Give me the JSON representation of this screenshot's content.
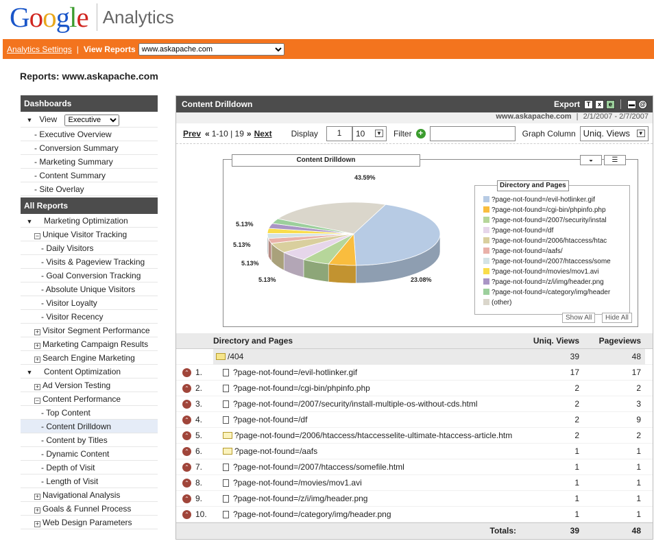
{
  "header": {
    "logo_text": "Google",
    "product": "Analytics"
  },
  "topbar": {
    "settings_link": "Analytics Settings",
    "separator": "|",
    "view_reports_label": "View Reports",
    "site_select": "www.askapache.com"
  },
  "report_title": "Reports: www.askapache.com",
  "sidebar": {
    "dashboards_title": "Dashboards",
    "view_label": "View",
    "view_value": "Executive",
    "dash_items": [
      "- Executive Overview",
      "- Conversion Summary",
      "- Marketing Summary",
      "- Content Summary",
      "- Site Overlay"
    ],
    "all_reports_title": "All Reports",
    "items": [
      {
        "label": "Marketing Optimization",
        "kind": "section"
      },
      {
        "label": "Unique Visitor Tracking",
        "kind": "minus"
      },
      {
        "label": "- Daily Visitors",
        "kind": "sub"
      },
      {
        "label": "- Visits & Pageview Tracking",
        "kind": "sub"
      },
      {
        "label": "- Goal Conversion Tracking",
        "kind": "sub"
      },
      {
        "label": "- Absolute Unique Visitors",
        "kind": "sub"
      },
      {
        "label": "- Visitor Loyalty",
        "kind": "sub"
      },
      {
        "label": "- Visitor Recency",
        "kind": "sub"
      },
      {
        "label": "Visitor Segment Performance",
        "kind": "plus"
      },
      {
        "label": "Marketing Campaign Results",
        "kind": "plus"
      },
      {
        "label": "Search Engine Marketing",
        "kind": "plus"
      },
      {
        "label": "Content Optimization",
        "kind": "section"
      },
      {
        "label": "Ad Version Testing",
        "kind": "plus"
      },
      {
        "label": "Content Performance",
        "kind": "minus"
      },
      {
        "label": "- Top Content",
        "kind": "sub"
      },
      {
        "label": "- Content Drilldown",
        "kind": "sub",
        "selected": true
      },
      {
        "label": "- Content by Titles",
        "kind": "sub"
      },
      {
        "label": "- Dynamic Content",
        "kind": "sub"
      },
      {
        "label": "- Depth of Visit",
        "kind": "sub"
      },
      {
        "label": "- Length of Visit",
        "kind": "sub"
      },
      {
        "label": "Navigational Analysis",
        "kind": "plus"
      },
      {
        "label": "Goals & Funnel Process",
        "kind": "plus"
      },
      {
        "label": "Web Design Parameters",
        "kind": "plus"
      }
    ]
  },
  "panel": {
    "title": "Content Drilldown",
    "export_label": "Export",
    "site": "www.askapache.com",
    "date_range": "2/1/2007 - 2/7/2007",
    "prev": "Prev",
    "range_text": "1-10 | 19",
    "next": "Next",
    "display_label": "Display",
    "display_start": "1",
    "display_count": "10",
    "filter_label": "Filter",
    "graph_label": "Graph Column",
    "graph_value": "Uniq. Views"
  },
  "chart_data": {
    "type": "pie",
    "title": "Content Drilldown",
    "legend_title": "Directory and Pages",
    "labels": [
      "?page-not-found=/evil-hotlinker.gif",
      "?page-not-found=/cgi-bin/phpinfo.php",
      "?page-not-found=/2007/security/instal",
      "?page-not-found=/df",
      "?page-not-found=/2006/htaccess/htac",
      "?page-not-found=/aafs/",
      "?page-not-found=/2007/htaccess/some",
      "?page-not-found=/movies/mov1.avi",
      "?page-not-found=/z/i/img/header.png",
      "?page-not-found=/category/img/header",
      "(other)"
    ],
    "values": [
      17,
      2,
      2,
      2,
      2,
      1,
      1,
      1,
      1,
      1,
      9
    ],
    "percent_labels": [
      "43.59%",
      "5.13%",
      "5.13%",
      "5.13%",
      "5.13%",
      "23.08%"
    ],
    "colors": [
      "#b7cbe4",
      "#f9bd3e",
      "#b6d69a",
      "#e6d6ea",
      "#d9cf9e",
      "#e9b1a9",
      "#d3e3e6",
      "#f9dd4b",
      "#a995c5",
      "#9ccf9c",
      "#dad6cb"
    ],
    "show_all": "Show All",
    "hide_all": "Hide All"
  },
  "table": {
    "headers": [
      "Directory and Pages",
      "Uniq. Views",
      "Pageviews"
    ],
    "folder": {
      "name": "/404",
      "uniq": "39",
      "views": "48"
    },
    "rows": [
      {
        "n": "1.",
        "name": "?page-not-found=/evil-hotlinker.gif",
        "uniq": "17",
        "views": "17",
        "icon": "doc"
      },
      {
        "n": "2.",
        "name": "?page-not-found=/cgi-bin/phpinfo.php",
        "uniq": "2",
        "views": "2",
        "icon": "doc"
      },
      {
        "n": "3.",
        "name": "?page-not-found=/2007/security/install-multiple-os-without-cds.html",
        "uniq": "2",
        "views": "3",
        "icon": "doc"
      },
      {
        "n": "4.",
        "name": "?page-not-found=/df",
        "uniq": "2",
        "views": "9",
        "icon": "doc"
      },
      {
        "n": "5.",
        "name": "?page-not-found=/2006/htaccess/htaccesselite-ultimate-htaccess-article.htm",
        "uniq": "2",
        "views": "2",
        "icon": "folder"
      },
      {
        "n": "6.",
        "name": "?page-not-found=/aafs",
        "uniq": "1",
        "views": "1",
        "icon": "folder"
      },
      {
        "n": "7.",
        "name": "?page-not-found=/2007/htaccess/somefile.html",
        "uniq": "1",
        "views": "1",
        "icon": "doc"
      },
      {
        "n": "8.",
        "name": "?page-not-found=/movies/mov1.avi",
        "uniq": "1",
        "views": "1",
        "icon": "doc"
      },
      {
        "n": "9.",
        "name": "?page-not-found=/z/i/img/header.png",
        "uniq": "1",
        "views": "1",
        "icon": "doc"
      },
      {
        "n": "10.",
        "name": "?page-not-found=/category/img/header.png",
        "uniq": "1",
        "views": "1",
        "icon": "doc"
      }
    ],
    "totals_label": "Totals:",
    "total_uniq": "39",
    "total_views": "48"
  }
}
